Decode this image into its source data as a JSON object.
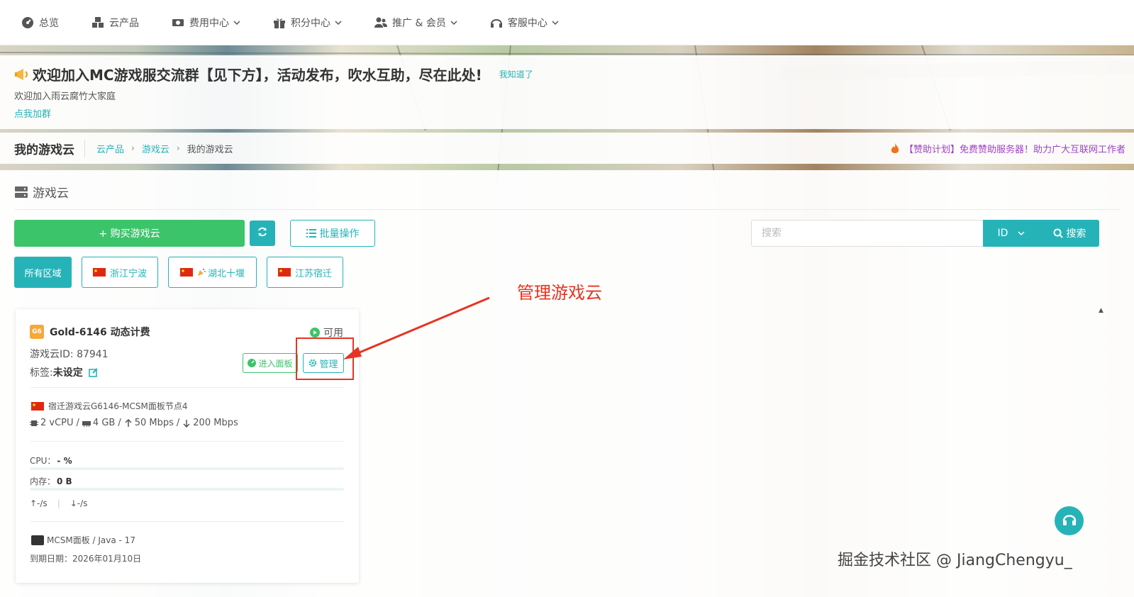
{
  "nav": {
    "items": [
      {
        "label": "总览",
        "icon": "dashboard-icon",
        "dropdown": false
      },
      {
        "label": "云产品",
        "icon": "cubes-icon",
        "dropdown": false
      },
      {
        "label": "费用中心",
        "icon": "money-icon",
        "dropdown": true
      },
      {
        "label": "积分中心",
        "icon": "gift-icon",
        "dropdown": true
      },
      {
        "label": "推广 & 会员",
        "icon": "users-icon",
        "dropdown": true
      },
      {
        "label": "客服中心",
        "icon": "headset-icon",
        "dropdown": true
      }
    ]
  },
  "notice": {
    "title": "欢迎加入MC游戏服交流群【见下方】，活动发布，吹水互助，尽在此处!",
    "dismiss": "我知道了",
    "subtitle": "欢迎加入雨云腐竹大家庭",
    "link": "点我加群"
  },
  "breadcrumb": {
    "page_title": "我的游戏云",
    "items": [
      "云产品",
      "游戏云"
    ],
    "current": "我的游戏云",
    "promo": "【赞助计划】免费赞助服务器！助力广大互联网工作者"
  },
  "main": {
    "section_title": "游戏云",
    "buy_label": "+ 购买游戏云",
    "batch_label": "批量操作",
    "search_placeholder": "搜索",
    "id_select": "ID",
    "search_label": "搜索",
    "regions": [
      {
        "label": "所有区域",
        "flag": false,
        "active": true
      },
      {
        "label": "浙江宁波",
        "flag": true,
        "active": false
      },
      {
        "label": "湖北十堰",
        "flag": true,
        "active": false
      },
      {
        "label": "江苏宿迁",
        "flag": true,
        "active": false
      }
    ]
  },
  "annotation": {
    "text": "管理游戏云",
    "color": "#e53522"
  },
  "card": {
    "badge": "G6",
    "title": "Gold-6146 动态计费",
    "status": "可用",
    "id_label": "游戏云ID: 87941",
    "tag_label": "标签: ",
    "tag_value": "未设定",
    "panel_label": "进入面板",
    "manage_label": "管理",
    "node": "宿迁游戏云G6146-MCSM面板节点4",
    "spec": {
      "cpu": "2 vCPU",
      "ram": "4 GB",
      "up": "50 Mbps",
      "down": "200 Mbps"
    },
    "cpu_label": "CPU：",
    "cpu_value": "- %",
    "cpu_usage": 0,
    "mem_label": "内存：",
    "mem_value": "0 B",
    "mem_usage": 0,
    "net_up": "↑-/s",
    "net_sep": "|",
    "net_down": "↓-/s",
    "runtime": "MCSM面板 / Java - 17",
    "expire": "到期日期：2026年01月10日"
  },
  "watermark": "掘金技术社区 @ JiangChengyu_",
  "colors": {
    "accent": "#26b3b8",
    "green": "#3cc46a",
    "promo": "#a040c8"
  }
}
